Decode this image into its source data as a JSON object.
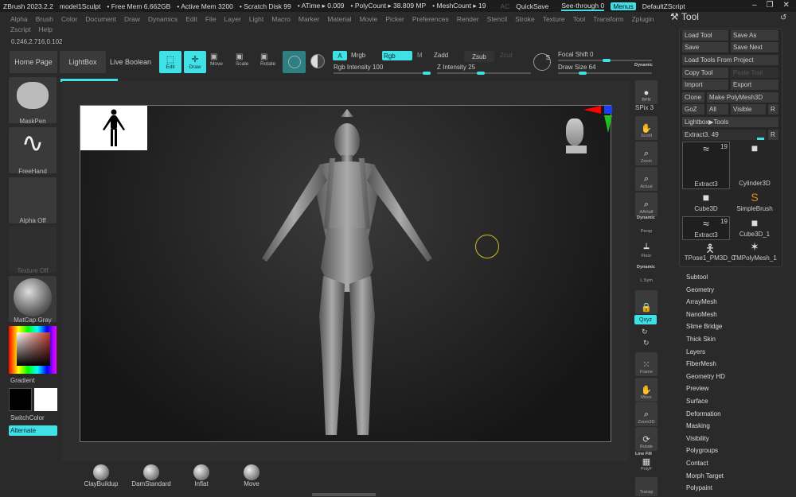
{
  "titlebar": {
    "app": "ZBrush 2023.2.2",
    "doc": "model1Sculpt",
    "free_mem": "• Free Mem 6.662GB",
    "active_mem": "• Active Mem 3200",
    "scratch": "• Scratch Disk 99",
    "atime": "• ATime ▸ 0.009",
    "polycount": "• PolyCount ▸ 38.809 MP",
    "meshcount": "• MeshCount ▸ 19",
    "ac": "AC",
    "quicksave": "QuickSave",
    "seethrough": "See-through  0",
    "menus": "Menus",
    "script": "DefaultZScript"
  },
  "menu": [
    "Alpha",
    "Brush",
    "Color",
    "Document",
    "Draw",
    "Dynamics",
    "Edit",
    "File",
    "Layer",
    "Light",
    "Macro",
    "Marker",
    "Material",
    "Movie",
    "Picker",
    "Preferences",
    "Render",
    "Stencil",
    "Stroke",
    "Texture",
    "Tool",
    "Transform",
    "Zplugin"
  ],
  "menu2": [
    "Zscript",
    "Help"
  ],
  "coords": "0.246,2.716,0.102",
  "toolbar": {
    "home": "Home Page",
    "lightbox": "LightBox",
    "live_boolean": "Live Boolean",
    "edit": "Edit",
    "draw": "Draw",
    "move": "Move",
    "scale": "Scale",
    "rotate": "Rotate",
    "a": "A",
    "mrgb": "Mrgb",
    "rgb": "Rgb",
    "m": "M",
    "zadd": "Zadd",
    "zsub": "Zsub",
    "zcut": "Zcut",
    "rgb_intensity": "Rgb Intensity 100",
    "z_intensity": "Z Intensity 25",
    "focal_shift": "Focal Shift 0",
    "draw_size": "Draw Size 64",
    "dynamic": "Dynamic",
    "rgb_intensity_value": 100,
    "z_intensity_value": 25,
    "draw_size_value": 64
  },
  "left": {
    "maskpen": "MaskPen",
    "freehand": "FreeHand",
    "alpha": "Alpha Off",
    "texture": "Texture Off",
    "material": "MatCap Gray",
    "gradient": "Gradient",
    "switchcolor": "SwitchColor",
    "alternate": "Alternate"
  },
  "rightshelf": {
    "bpr": "BPR",
    "spix": "SPix 3",
    "scroll": "Scroll",
    "zoom": "Zoom",
    "actual": "Actual",
    "aahalf": "AAHalf",
    "dynamic": "Dynamic",
    "persp": "Persp",
    "floor": "Floor",
    "dynamic2": "Dynamic",
    "lsym": "L.Sym",
    "xyz": "Qxyz",
    "frame": "Frame",
    "move": "Move",
    "zoom3d": "Zoom3D",
    "rotate": "Rotate",
    "linefill": "Line Fill",
    "polyf": "PolyF",
    "transp": "Transp"
  },
  "tool": {
    "title": "Tool",
    "load": "Load Tool",
    "saveas": "Save As",
    "save": "Save",
    "savenext": "Save Next",
    "loadproject": "Load Tools From Project",
    "copy": "Copy Tool",
    "paste": "Paste Tool",
    "import": "Import",
    "export": "Export",
    "clone": "Clone",
    "makepoly": "Make PolyMesh3D",
    "goz": "GoZ",
    "all": "All",
    "visible": "Visible",
    "r": "R",
    "lightbox": "Lightbox▶Tools",
    "extract": "Extract3. 49",
    "thumbs": [
      {
        "label": "Extract3",
        "count": "19"
      },
      {
        "label": "Cylinder3D"
      },
      {
        "label": "SimpleBrush"
      },
      {
        "label": "Cube3D"
      },
      {
        "label": "Cube3D_1"
      },
      {
        "label": "Extract3",
        "count": "19"
      },
      {
        "label": "TMPolyMesh_1"
      },
      {
        "label": "TPose1_PM3D_C"
      }
    ],
    "subpalettes": [
      "Subtool",
      "Geometry",
      "ArrayMesh",
      "NanoMesh",
      "Slime Bridge",
      "Thick Skin",
      "Layers",
      "FiberMesh",
      "Geometry HD",
      "Preview",
      "Surface",
      "Deformation",
      "Masking",
      "Visibility",
      "Polygroups",
      "Contact",
      "Morph Target",
      "Polypaint"
    ]
  },
  "shelf": [
    "ClayBuildup",
    "DamStandard",
    "Inflat",
    "Move"
  ]
}
